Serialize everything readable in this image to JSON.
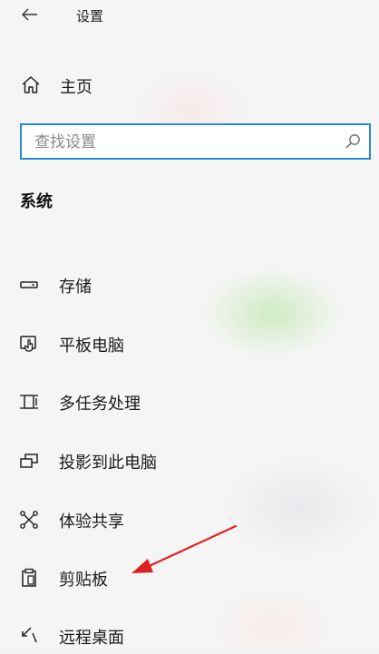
{
  "window": {
    "title": "设置"
  },
  "nav": {
    "home_label": "主页"
  },
  "search": {
    "placeholder": "查找设置",
    "value": ""
  },
  "section": {
    "title": "系统"
  },
  "items": [
    {
      "label": "存储",
      "icon": "storage-icon"
    },
    {
      "label": "平板电脑",
      "icon": "tablet-icon"
    },
    {
      "label": "多任务处理",
      "icon": "multitasking-icon"
    },
    {
      "label": "投影到此电脑",
      "icon": "projecting-icon"
    },
    {
      "label": "体验共享",
      "icon": "shared-experiences-icon"
    },
    {
      "label": "剪贴板",
      "icon": "clipboard-icon"
    },
    {
      "label": "远程桌面",
      "icon": "remote-desktop-icon"
    }
  ],
  "colors": {
    "search_border": "#2b88d8",
    "annotation_arrow": "#e02020"
  }
}
